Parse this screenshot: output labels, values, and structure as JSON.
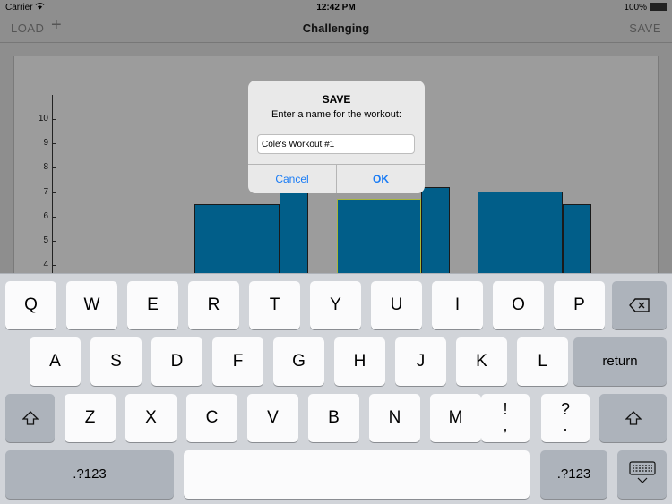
{
  "status_bar": {
    "carrier": "Carrier",
    "wifi_icon": "wifi-icon",
    "time": "12:42 PM",
    "battery": "100%"
  },
  "nav": {
    "load": "LOAD",
    "add": "+",
    "title": "Challenging",
    "save": "SAVE"
  },
  "chart_data": {
    "type": "bar",
    "y_ticks": [
      "10",
      "9",
      "8",
      "7",
      "6",
      "5",
      "4"
    ],
    "visible_bars": [
      6.5,
      7.0,
      6.7,
      7.2,
      7.0,
      6.5
    ],
    "selected_bar_index": 2,
    "color": "#015e89"
  },
  "alert": {
    "title": "SAVE",
    "message": "Enter a name for the workout:",
    "input_value": "Cole's Workout #1",
    "cancel": "Cancel",
    "ok": "OK"
  },
  "keyboard": {
    "row1": [
      "Q",
      "W",
      "E",
      "R",
      "T",
      "Y",
      "U",
      "I",
      "O",
      "P"
    ],
    "row2": [
      "A",
      "S",
      "D",
      "F",
      "G",
      "H",
      "J",
      "K",
      "L"
    ],
    "row3": [
      "Z",
      "X",
      "C",
      "V",
      "B",
      "N",
      "M"
    ],
    "return": "return",
    "excl": [
      "!",
      ","
    ],
    "quest": [
      "?",
      "."
    ],
    "num_left": ".?123",
    "num_right": ".?123",
    "backspace_icon": "backspace-icon",
    "shift_icon": "shift-icon",
    "hide_keyboard_icon": "keyboard-hide-icon"
  }
}
